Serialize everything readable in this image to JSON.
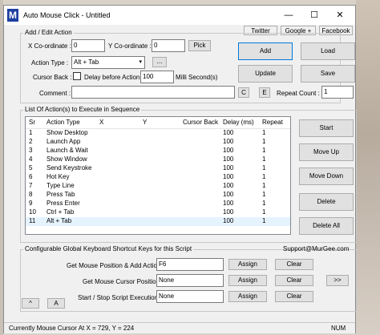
{
  "window": {
    "title": "Auto Mouse Click - Untitled",
    "logo": "M"
  },
  "controls": {
    "minimize": "—",
    "maximize": "☐",
    "close": "✕"
  },
  "links": {
    "twitter": "Twitter",
    "google": "Google +",
    "facebook": "Facebook"
  },
  "add_edit": {
    "group_title": "Add / Edit Action",
    "x_label": "X Co-ordinate :",
    "x_value": "0",
    "y_label": "Y Co-ordinate :",
    "y_value": "0",
    "pick": "Pick",
    "action_type_label": "Action Type :",
    "action_type_value": "Alt + Tab",
    "more": "...",
    "cursor_back_label": "Cursor Back :",
    "delay_label": "Delay before Action :",
    "delay_value": "100",
    "delay_unit": "Milli Second(s)",
    "comment_label": "Comment :",
    "comment_value": "",
    "c_btn": "C",
    "e_btn": "E",
    "repeat_label": "Repeat Count :",
    "repeat_value": "1"
  },
  "action_buttons": {
    "add": "Add",
    "load": "Load",
    "update": "Update",
    "save": "Save"
  },
  "list": {
    "group_title": "List Of Action(s) to Execute in Sequence",
    "columns": [
      "Sr",
      "Action Type",
      "X",
      "Y",
      "Cursor Back",
      "Delay (ms)",
      "Repeat"
    ],
    "rows": [
      {
        "sr": "1",
        "type": "Show Desktop",
        "delay": "100",
        "repeat": "1"
      },
      {
        "sr": "2",
        "type": "Launch App",
        "delay": "100",
        "repeat": "1"
      },
      {
        "sr": "3",
        "type": "Launch & Wait",
        "delay": "100",
        "repeat": "1"
      },
      {
        "sr": "4",
        "type": "Show Window",
        "delay": "100",
        "repeat": "1"
      },
      {
        "sr": "5",
        "type": "Send Keystroke",
        "delay": "100",
        "repeat": "1"
      },
      {
        "sr": "6",
        "type": "Hot Key",
        "delay": "100",
        "repeat": "1"
      },
      {
        "sr": "7",
        "type": "Type Line",
        "delay": "100",
        "repeat": "1"
      },
      {
        "sr": "8",
        "type": "Press Tab",
        "delay": "100",
        "repeat": "1"
      },
      {
        "sr": "9",
        "type": "Press Enter",
        "delay": "100",
        "repeat": "1"
      },
      {
        "sr": "10",
        "type": "Ctrl + Tab",
        "delay": "100",
        "repeat": "1"
      },
      {
        "sr": "11",
        "type": "Alt + Tab",
        "delay": "100",
        "repeat": "1"
      }
    ]
  },
  "side_buttons": {
    "start": "Start",
    "move_up": "Move Up",
    "move_down": "Move Down",
    "delete": "Delete",
    "delete_all": "Delete All"
  },
  "shortcuts": {
    "group_title": "Configurable Global Keyboard Shortcut Keys for this Script",
    "support": "Support@MurGee.com",
    "row1_label": "Get Mouse Position & Add Action :",
    "row1_value": "F6",
    "row2_label": "Get Mouse Cursor Position :",
    "row2_value": "None",
    "row3_label": "Start / Stop Script Execution :",
    "row3_value": "None",
    "assign": "Assign",
    "clear": "Clear",
    "more": ">>",
    "up": "^",
    "a": "A"
  },
  "status": {
    "text": "Currently Mouse Cursor At X = 729, Y = 224",
    "num": "NUM"
  }
}
